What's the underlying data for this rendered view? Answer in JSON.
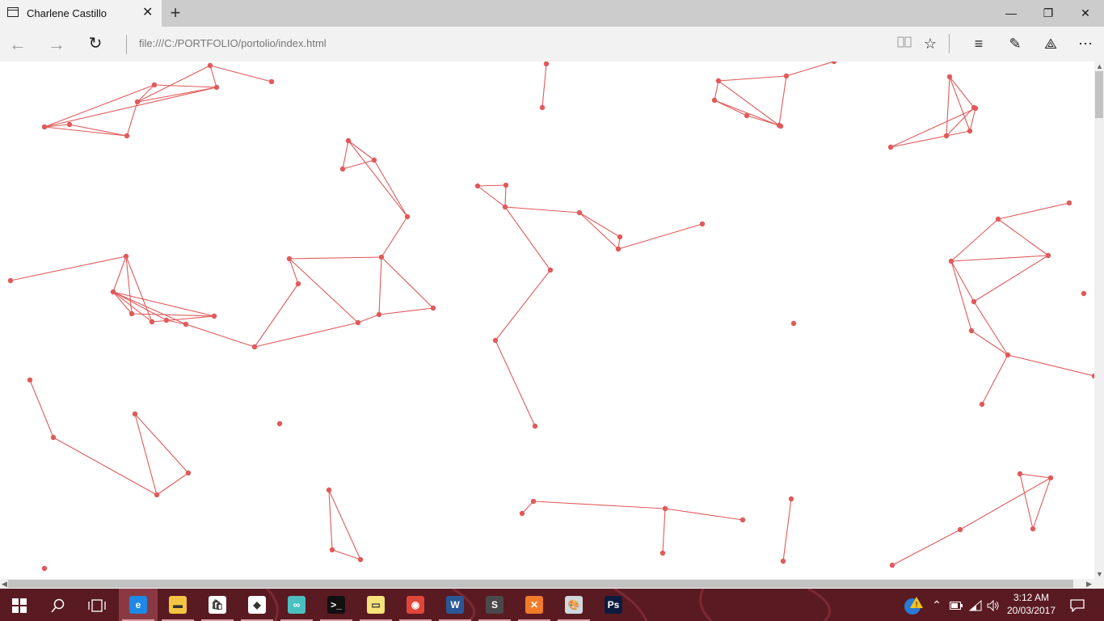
{
  "tab": {
    "title": "Charlene Castillo"
  },
  "address": {
    "url": "file:///C:/PORTFOLIO/portolio/index.html"
  },
  "icons": {
    "tab_page": "page-icon",
    "tab_close": "✕",
    "new_tab": "+",
    "minimize": "—",
    "maximize": "❐",
    "close": "✕",
    "back": "←",
    "forward": "→",
    "refresh": "↻",
    "reading_view": "📖",
    "favorite": "☆",
    "hub": "≡",
    "notes": "✎",
    "share": "⟁",
    "more": "⋯",
    "start": "⊞",
    "search": "⚲",
    "task_view": "⧉"
  },
  "canvas": {
    "node_color": "#e05a5a",
    "line_color": "#e05a5a"
  },
  "taskbar": {
    "background": "#5a1a22",
    "apps": [
      {
        "name": "edge",
        "label": "e",
        "color": "#1e88e5",
        "active": true
      },
      {
        "name": "file-explorer",
        "label": "▬",
        "color": "#f4c542",
        "active": false
      },
      {
        "name": "store",
        "label": "🛍",
        "color": "#ffffff",
        "active": false
      },
      {
        "name": "dropbox",
        "label": "◆",
        "color": "#ffffff",
        "active": false
      },
      {
        "name": "infinity",
        "label": "∞",
        "color": "#4ac0c0",
        "active": false
      },
      {
        "name": "cmd",
        "label": ">_",
        "color": "#111111",
        "active": false
      },
      {
        "name": "sticky-notes",
        "label": "▭",
        "color": "#f7e37a",
        "active": false
      },
      {
        "name": "chrome",
        "label": "◉",
        "color": "#e0463a",
        "active": false
      },
      {
        "name": "word",
        "label": "W",
        "color": "#2b5797",
        "active": false
      },
      {
        "name": "sublime",
        "label": "S",
        "color": "#4a4a4a",
        "active": false
      },
      {
        "name": "xampp",
        "label": "✕",
        "color": "#f27b2a",
        "active": false
      },
      {
        "name": "paint",
        "label": "🎨",
        "color": "#cfd8dc",
        "active": false
      },
      {
        "name": "photoshop",
        "label": "Ps",
        "color": "#0d1b3e",
        "active": false
      }
    ],
    "tray": {
      "up_arrow": "⌃",
      "battery": "▭",
      "wifi": "◠",
      "volume": "🔊",
      "notification": "🗨"
    },
    "time": "3:12 AM",
    "date": "20/03/2017"
  }
}
